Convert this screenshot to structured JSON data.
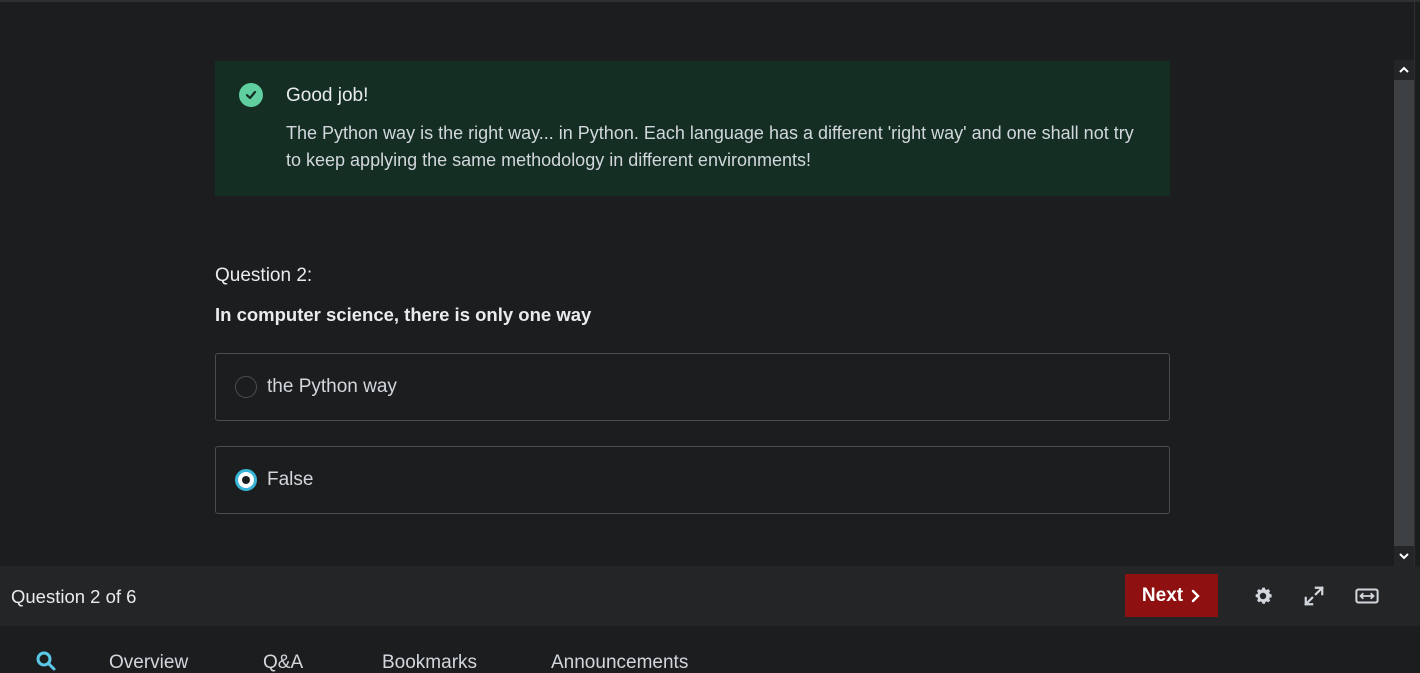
{
  "feedback": {
    "title": "Good job!",
    "body": "The Python way is the right way... in Python. Each language has a different 'right way' and one shall not try to keep applying the same methodology in different environments!"
  },
  "question": {
    "label": "Question 2:",
    "prompt": "In computer science, there is only one way",
    "answers": [
      {
        "text": "the Python way",
        "selected": false
      },
      {
        "text": "False",
        "selected": true
      }
    ]
  },
  "footer": {
    "progress": "Question 2 of 6",
    "next_label": "Next"
  },
  "tabs": [
    "Overview",
    "Q&A",
    "Bookmarks",
    "Announcements"
  ],
  "colors": {
    "feedback_bg": "#152e23",
    "check": "#5fcf9f",
    "radio_selected": "#39b6d6",
    "next_button": "#8e1010",
    "search_icon": "#5bc8e8"
  }
}
